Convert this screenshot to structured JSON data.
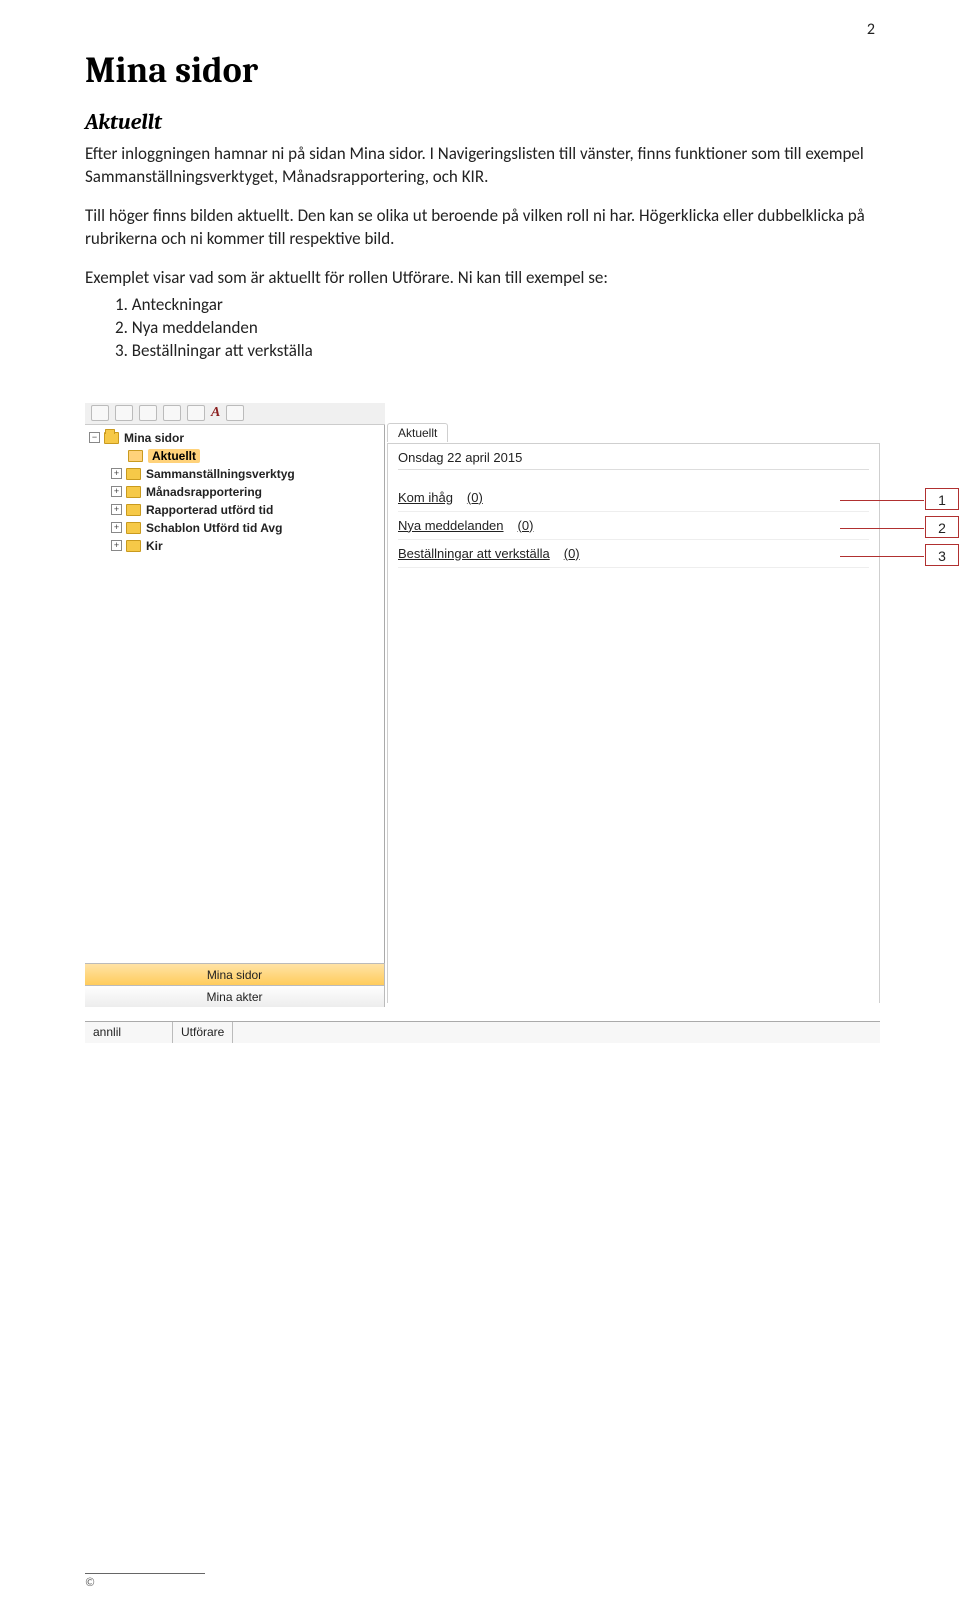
{
  "page_number": "2",
  "heading1": "Mina sidor",
  "heading2": "Aktuellt",
  "paragraphs": {
    "p1": "Efter inloggningen hamnar ni på sidan Mina sidor. I Navigeringslisten till vänster, finns funktioner som till exempel Sammanställningsverktyget, Månadsrapportering, och KIR.",
    "p2": "Till höger finns bilden aktuellt. Den kan se olika ut beroende på vilken roll ni har. Högerklicka eller dubbelklicka på rubrikerna och ni kommer till respektive bild.",
    "p3": "Exemplet visar vad som är aktuellt för rollen Utförare. Ni kan till exempel se:"
  },
  "list": {
    "i1": "1.   Anteckningar",
    "i2": "2.   Nya meddelanden",
    "i3": "3.   Beställningar att verkställa"
  },
  "tree": {
    "root": "Mina sidor",
    "aktuellt": "Aktuellt",
    "sammanstallning": "Sammanställningsverktyg",
    "manads": "Månadsrapportering",
    "rapporterad": "Rapporterad utförd tid",
    "schablon": "Schablon Utförd tid Avg",
    "kir": "Kir"
  },
  "switcher": {
    "active": "Mina sidor",
    "inactive": "Mina akter"
  },
  "right_panel": {
    "tab": "Aktuellt",
    "date": "Onsdag 22 april 2015",
    "line1_label": "Kom ihåg",
    "line1_count": "(0)",
    "line2_label": "Nya meddelanden",
    "line2_count": "(0)",
    "line3_label": "Beställningar att verkställa",
    "line3_count": "(0)"
  },
  "callouts": {
    "c1": "1",
    "c2": "2",
    "c3": "3"
  },
  "status": {
    "user": "annlil",
    "role": "Utförare"
  },
  "copyright": "©"
}
